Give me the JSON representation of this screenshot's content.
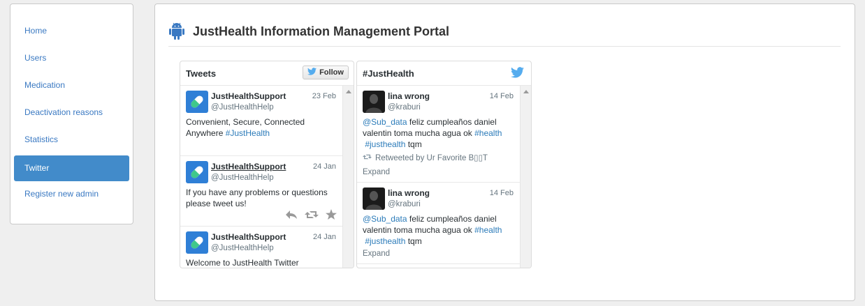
{
  "sidebar": {
    "items": [
      {
        "label": "Home",
        "active": false
      },
      {
        "label": "Users",
        "active": false
      },
      {
        "label": "Medication",
        "active": false
      },
      {
        "label": "Deactivation reasons",
        "active": false
      },
      {
        "label": "Statistics",
        "active": false
      },
      {
        "label": "Twitter",
        "active": true
      },
      {
        "label": "Register new admin",
        "active": false
      }
    ]
  },
  "header": {
    "icon": "android-icon",
    "title": "JustHealth Information Management Portal"
  },
  "tweets_timeline": {
    "title": "Tweets",
    "follow_label": "Follow",
    "items": [
      {
        "name": "JustHealthSupport",
        "handle": "@JustHealthHelp",
        "date": "23 Feb",
        "text": "Convenient, Secure, Connected Anywhere ",
        "hashtag": "#JustHealth"
      },
      {
        "name": "JustHealthSupport",
        "handle": "@JustHealthHelp",
        "date": "24 Jan",
        "text": "If you have any problems or questions please tweet us!"
      },
      {
        "name": "JustHealthSupport",
        "handle": "@JustHealthHelp",
        "date": "24 Jan",
        "text": "Welcome to JustHealth Twitter"
      }
    ]
  },
  "hashtag_timeline": {
    "title": "#JustHealth",
    "items": [
      {
        "name": "lina wrong",
        "handle": "@kraburi",
        "date": "14 Feb",
        "mention": "@Sub_data",
        "text": " feliz cumpleaños daniel valentin toma mucha agua ok ",
        "hashtag1": "#health",
        "hashtag2": "#justhealth",
        "tail": " tqm",
        "retweeted": "Retweeted by Ur Favorite B▯▯T",
        "expand": "Expand"
      },
      {
        "name": "lina wrong",
        "handle": "@kraburi",
        "date": "14 Feb",
        "mention": "@Sub_data",
        "text": " feliz cumpleaños daniel valentin toma mucha agua ok ",
        "hashtag1": "#health",
        "hashtag2": "#justhealth",
        "tail": " tqm",
        "expand": "Expand"
      }
    ]
  },
  "colors": {
    "accent": "#428bca",
    "link": "#3a79c2",
    "twitter": "#55acee",
    "android": "#3a79c2"
  }
}
